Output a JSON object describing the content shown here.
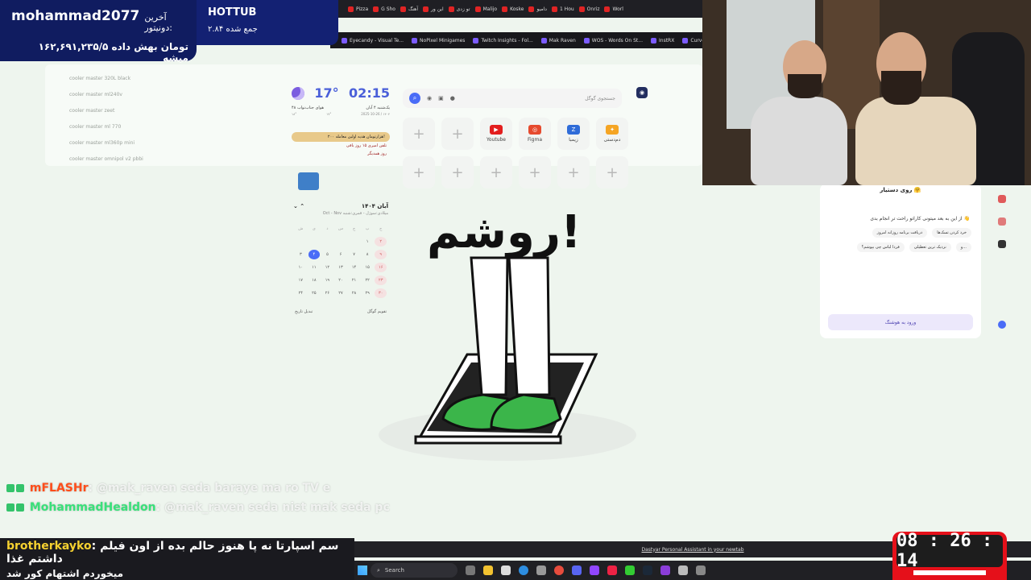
{
  "donation": {
    "donor": "mohammad2077",
    "label": "آخرین دونیتور:",
    "amount": "۱۶۲,۶۹۱,۲۳۵/۵ تومان بهش داده میشه"
  },
  "hottub": {
    "title": "HOTTUB",
    "subtitle": "۲.۸۴ جمع شده"
  },
  "tabs": [
    "Pizza",
    "G Sho",
    "آهنگ",
    "این ور",
    "تو زدی",
    "Malijo",
    "Koske",
    "دامیو",
    "1 Hou",
    "Onriz",
    "Worl"
  ],
  "bookmarks": [
    "Eyecandy - Visual Te...",
    "NoPixel Minigames",
    "Twitch Insights - Fol...",
    "Mak Raven",
    "WOS - Words On St...",
    "InstRX",
    "Curve Fever Pro - 2..."
  ],
  "suggestions": [
    "cooler master 320L black",
    "cooler master ml240v",
    "cooler master zeet",
    "cooler master ml 770",
    "cooler master ml360p mini",
    "cooler master omnipol v2 pbbi"
  ],
  "weather": {
    "temp": "17°",
    "time": "02:15",
    "city": "هوای جناب‌نواب ۴۸",
    "day": "یک‌شنبه ۴ آبان",
    "min": "۱۸°",
    "max": "۱۷°",
    "date_line": "2025-10-26 / ۱۴۰۴",
    "event": "۲۰۰ هزارتومان هدیه اولین معامله!",
    "ev1": "تلفن امیری ۱۵ روز باقی",
    "ev2": "روز همدیگر"
  },
  "search": {
    "placeholder": "جستجوی گوگل"
  },
  "shortcuts": [
    {
      "label": "دم‌دستی",
      "color": "#f5a524",
      "glyph": "✦"
    },
    {
      "label": "زیمبا",
      "color": "#2f6cd8",
      "glyph": "Z"
    },
    {
      "label": "Figma",
      "color": "#e64a2e",
      "glyph": "◎"
    },
    {
      "label": "Youtube",
      "color": "#e31e1e",
      "glyph": "▶"
    }
  ],
  "plus": "+",
  "calendar": {
    "title": "آبان ۱۴۰۴",
    "subtitle": "Oct - Nov  میلادی:سوژل - قمری:شنبه",
    "headers": [
      "ش",
      "ی",
      "د",
      "س",
      "چ",
      "پ",
      "ج"
    ],
    "days": [
      "",
      "",
      "",
      "",
      "",
      "۱",
      "۲",
      "۳",
      "۴",
      "۵",
      "۶",
      "۷",
      "۸",
      "۹",
      "۱۰",
      "۱۱",
      "۱۲",
      "۱۳",
      "۱۴",
      "۱۵",
      "۱۶",
      "۱۷",
      "۱۸",
      "۱۹",
      "۲۰",
      "۲۱",
      "۲۲",
      "۲۳",
      "۲۴",
      "۲۵",
      "۲۶",
      "۲۷",
      "۲۸",
      "۲۹",
      "۳۰"
    ],
    "today": "۴",
    "foot_left": "تبدیل تاریخ",
    "foot_right": "تقویم گوگل"
  },
  "hero": {
    "text": "روشم!"
  },
  "assistant": {
    "title": "روی دستیار 🤗",
    "desc": "از این به بعد میتونی کاراتو راحت تر انجام بدی 👋",
    "chips": [
      "دریافت برنامه روزانه امروز",
      "خرد کردن تسک‌ها",
      "فردا لباس چی بپوشم؟",
      "نزدیک ترین تعطیلی",
      "و..."
    ],
    "button": "ورود به هوشنگ"
  },
  "chat": {
    "m1_name": "mFLASHr",
    "m1_text": ": @mak_raven seda baraye ma ro TV e",
    "m2_name": "MohammadHealdon",
    "m2_text": ": @mak_raven seda nist mak seda pc",
    "box_name": "brotherkayko",
    "box_text1": ": سم اسپارتا نه پا هنوز حالم بده از اون فیلم داشتم غذا",
    "box_text2": "میخوردم اشتهام کور شد"
  },
  "status": {
    "text": "Dastyar Personal Assistant in your newtab"
  },
  "taskbar": {
    "search": "Search"
  },
  "timer": {
    "value": "08 : 26 : 14"
  }
}
